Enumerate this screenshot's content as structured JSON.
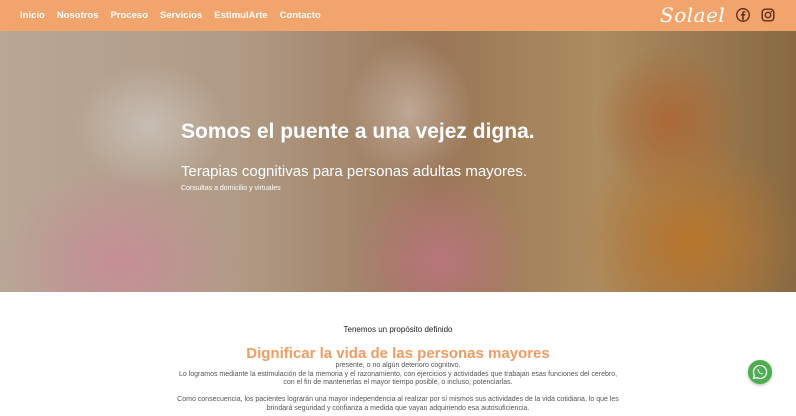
{
  "nav": {
    "links": [
      "Inicio",
      "Nosotros",
      "Proceso",
      "Servicios",
      "EstimulArte",
      "Contacto"
    ],
    "logo": "Solael",
    "accent_color": "#f2a46d"
  },
  "hero": {
    "title": "Somos el puente a una vejez digna.",
    "subtitle": "Terapias cognitivas para personas adultas mayores.",
    "note": "Consultas a domicilio y virtuales"
  },
  "content": {
    "purpose": "Tenemos un propósito definido",
    "headline": "Dignificar la vida de las personas mayores",
    "paragraph1": [
      "presente, o no algún deterioro cognitivo.",
      "Lo logramos mediante la estimulación de la memoria y el razonamiento, con ejercicios y actividades que trabajan esas funciones del cerebro,",
      "con el fin de mantenerlas el mayor tiempo posible, o incluso, potenciarlas."
    ],
    "paragraph2": [
      "Como consecuencia, los pacientes lograrán una mayor independencia al realizar por sí mismos sus actividades de la vida cotidiana, lo que les",
      "brindará seguridad y confianza a medida que vayan adquiriendo esa autosuficiencia."
    ]
  },
  "icons": {
    "facebook": "facebook-icon",
    "instagram": "instagram-icon",
    "whatsapp": "whatsapp-icon"
  }
}
